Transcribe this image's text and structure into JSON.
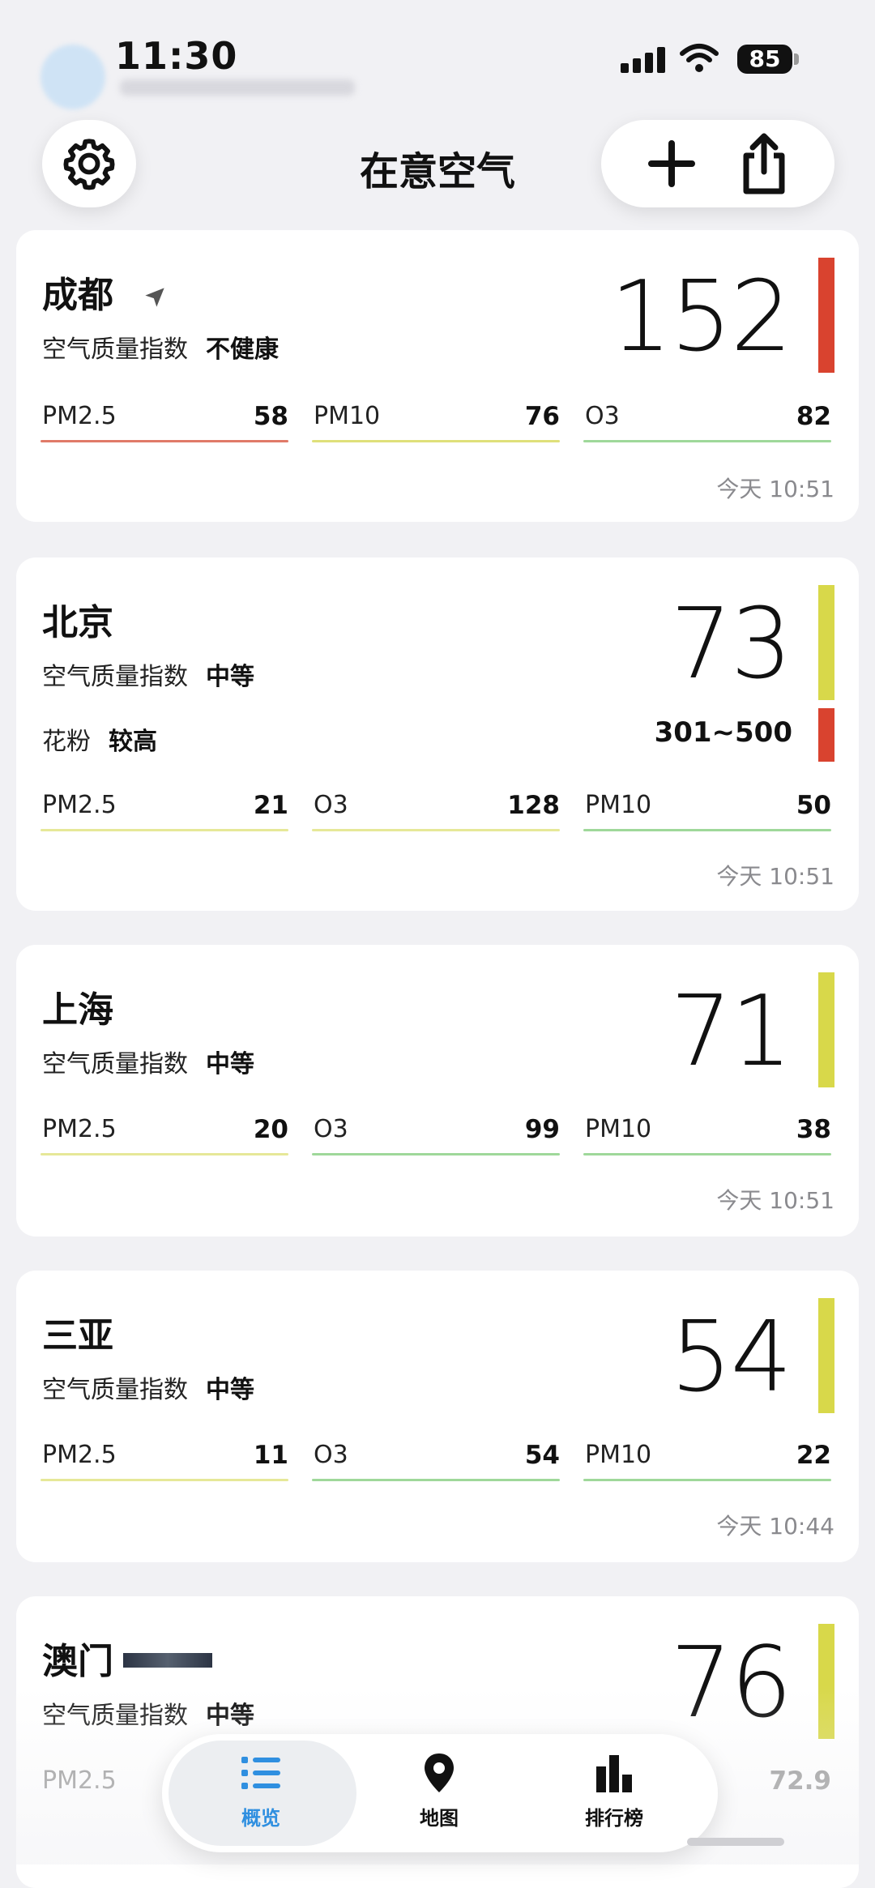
{
  "status_bar": {
    "time": "11:30",
    "battery": "85"
  },
  "header": {
    "title": "在意空气",
    "settings_icon": "gear-icon",
    "add_icon": "plus-icon",
    "share_icon": "share-icon"
  },
  "aqi_label": "空气质量指数",
  "colors": {
    "unhealthy": "#d9432f",
    "moderate": "#d8d84a",
    "good": "#7fcf80",
    "accent_blue": "#2f8fe0"
  },
  "cards": [
    {
      "city": "成都",
      "aqi": "152",
      "level": "不健康",
      "metrics": [
        {
          "name": "PM2.5",
          "value": "58"
        },
        {
          "name": "PM10",
          "value": "76"
        },
        {
          "name": "O3",
          "value": "82"
        }
      ],
      "time": "今天 10:51"
    },
    {
      "city": "北京",
      "aqi": "73",
      "level": "中等",
      "pollen_label": "花粉",
      "pollen_level": "较高",
      "pollen_value": "301~500",
      "metrics": [
        {
          "name": "PM2.5",
          "value": "21"
        },
        {
          "name": "O3",
          "value": "128"
        },
        {
          "name": "PM10",
          "value": "50"
        }
      ],
      "time": "今天 10:51"
    },
    {
      "city": "上海",
      "aqi": "71",
      "level": "中等",
      "metrics": [
        {
          "name": "PM2.5",
          "value": "20"
        },
        {
          "name": "O3",
          "value": "99"
        },
        {
          "name": "PM10",
          "value": "38"
        }
      ],
      "time": "今天 10:51"
    },
    {
      "city": "三亚",
      "aqi": "54",
      "level": "中等",
      "metrics": [
        {
          "name": "PM2.5",
          "value": "11"
        },
        {
          "name": "O3",
          "value": "54"
        },
        {
          "name": "PM10",
          "value": "22"
        }
      ],
      "time": "今天 10:44"
    },
    {
      "city": "澳门",
      "aqi": "76",
      "level": "中等",
      "metrics": [
        {
          "name": "PM2.5",
          "value": ""
        },
        {
          "name": "",
          "value": ""
        },
        {
          "name": "",
          "value": "72.9"
        }
      ]
    }
  ],
  "tabs": [
    {
      "label": "概览",
      "icon": "list-icon",
      "selected": true
    },
    {
      "label": "地图",
      "icon": "map-pin-icon",
      "selected": false
    },
    {
      "label": "排行榜",
      "icon": "bar-chart-icon",
      "selected": false
    }
  ]
}
